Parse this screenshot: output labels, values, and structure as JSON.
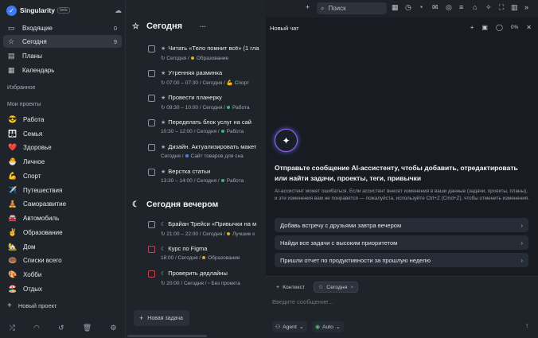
{
  "sidebar": {
    "app_name": "Singularity",
    "beta_badge": "beta",
    "nav": [
      {
        "label": "Входящие",
        "count": "0",
        "icon": "inbox-icon"
      },
      {
        "label": "Сегодня",
        "count": "9",
        "icon": "star-icon"
      },
      {
        "label": "Планы",
        "count": "",
        "icon": "calendar-icon"
      },
      {
        "label": "Календарь",
        "count": "",
        "icon": "calendar-grid-icon"
      }
    ],
    "favorites_label": "Избранное",
    "projects_label": "Мои проекты",
    "projects": [
      {
        "emoji": "😎",
        "label": "Работа"
      },
      {
        "emoji": "👪",
        "label": "Семья"
      },
      {
        "emoji": "❤️",
        "label": "Здоровье"
      },
      {
        "emoji": "🐣",
        "label": "Личное"
      },
      {
        "emoji": "💪",
        "label": "Спорт"
      },
      {
        "emoji": "✈️",
        "label": "Путешествия"
      },
      {
        "emoji": "🧘",
        "label": "Саморазвитие"
      },
      {
        "emoji": "🚘",
        "label": "Автомобиль"
      },
      {
        "emoji": "✌️",
        "label": "Образование"
      },
      {
        "emoji": "🏡",
        "label": "Дом"
      },
      {
        "emoji": "🍩",
        "label": "Списки всего"
      },
      {
        "emoji": "🎨",
        "label": "Хобби"
      },
      {
        "emoji": "🏖️",
        "label": "Отдых"
      }
    ],
    "new_project": "Новый проект"
  },
  "today": {
    "title": "Сегодня",
    "more": "···",
    "tasks": [
      {
        "title": "Читать «Тело помнит всё» (1 гла",
        "marker": "★",
        "meta": "Сегодня",
        "project": "Образование",
        "dot": "#d6b02a"
      },
      {
        "title": "Утренняя разминка",
        "marker": "★",
        "meta": "07:00 – 07:30 / Сегодня",
        "project": "Спорт",
        "dot": ""
      },
      {
        "title": "Провести планерку",
        "marker": "★",
        "meta": "09:30 – 10:00 / Сегодня",
        "project": "Работа",
        "dot": "#3fb27f"
      },
      {
        "title": "Переделать блок услуг на сай",
        "marker": "★",
        "meta": "10:30 – 12:00 / Сегодня",
        "project": "Работа",
        "dot": "#3fb27f"
      },
      {
        "title": "Дизайн. Актуализировать макет",
        "marker": "★",
        "meta": "Сегодня",
        "project": "Сайт товаров для сна",
        "dot": "#4a82f0"
      },
      {
        "title": "Верстка статьи",
        "marker": "★",
        "meta": "13:30 – 14:00 / Сегодня",
        "project": "Работа",
        "dot": "#3fb27f"
      }
    ]
  },
  "evening": {
    "title": "Сегодня вечером",
    "tasks": [
      {
        "title": "Брайан Трейси «Привычки на м",
        "marker": "☾",
        "meta": "21:00 – 22:00 / Сегодня",
        "project": "Лучшие к",
        "dot": "#d6b02a",
        "red": false
      },
      {
        "title": "Курс по Figma",
        "marker": "☾",
        "meta": "18:00 / Сегодня",
        "project": "Образование",
        "dot": "#d6b02a",
        "red": true
      },
      {
        "title": "Проверить дедлайны",
        "marker": "☾",
        "meta": "20:00 / Сегодня",
        "project": "Без проекта",
        "dot": "",
        "red": true
      }
    ]
  },
  "new_task": "Новая задача",
  "topbar": {
    "search_placeholder": "Поиск"
  },
  "chat": {
    "title": "Новый чат",
    "progress": "0%",
    "heading": "Отправьте сообщение AI-ассистенту, чтобы добавить, отредактировать или найти задачи, проекты, теги, привычки",
    "disclaimer": "AI-ассистент может ошибаться. Если ассистент внесет изменения в ваши данные (задачи, проекты, планы), и эти изменения вам не понравятся — пожалуйста, используйте Ctrl+Z (Cmd+Z), чтобы отменить изменения.",
    "suggestions": [
      "Добавь встречу с друзьями завтра вечером",
      "Найди все задачи с высоким приоритетом",
      "Пришли отчет по продуктивности за прошлую неделю"
    ],
    "context_chip": "Контекст",
    "today_chip": "Сегодня",
    "input_placeholder": "Введите сообщение...",
    "mode": "Agent",
    "model": "Auto"
  }
}
